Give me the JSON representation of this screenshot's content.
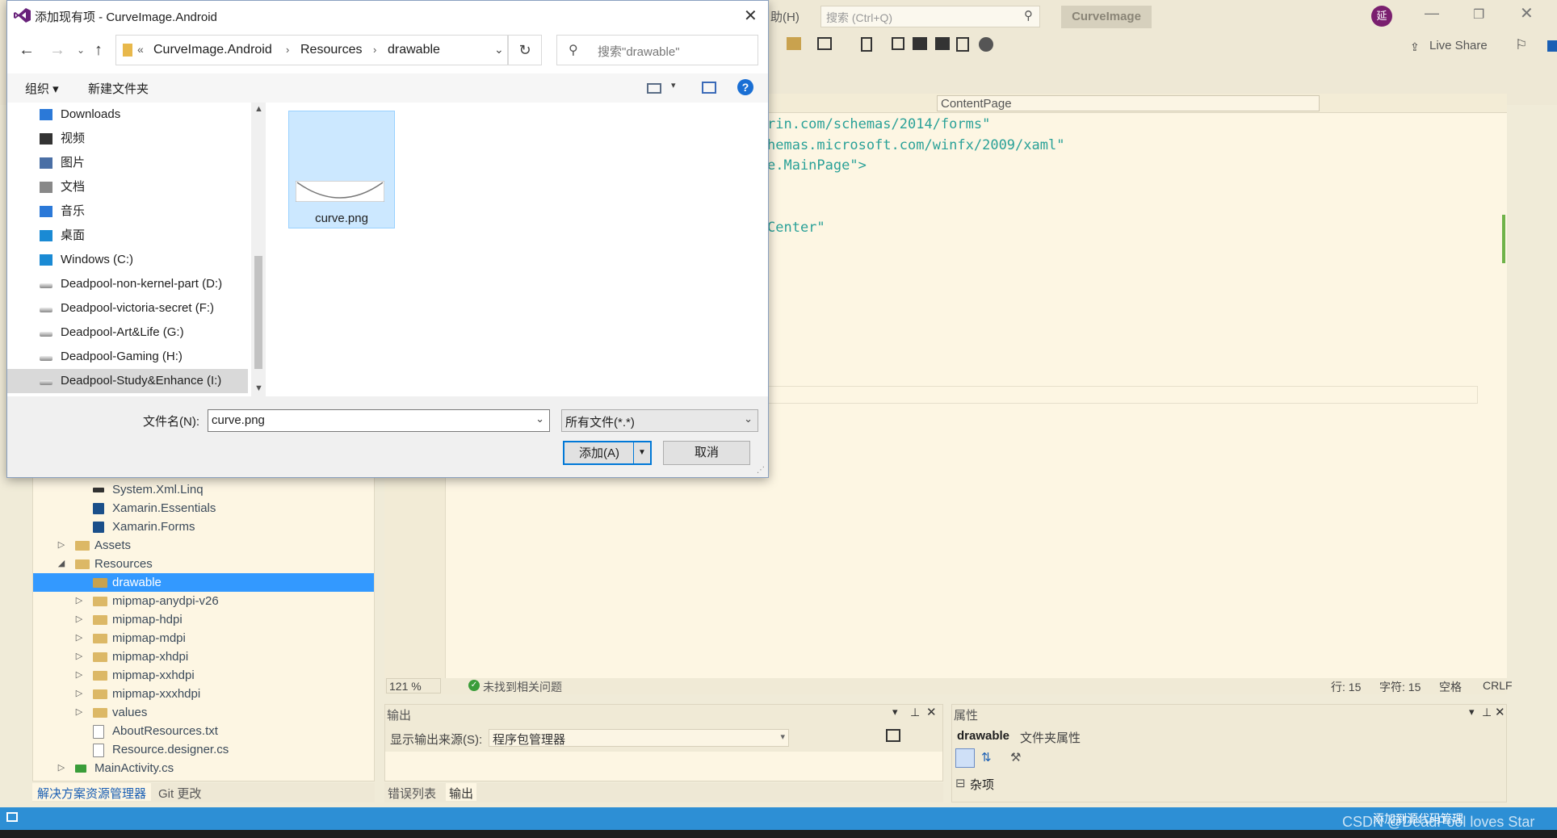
{
  "vs": {
    "menu_help_partial": "助(H)",
    "search_placeholder": "搜索 (Ctrl+Q)",
    "solution_title": "CurveImage",
    "avatar_letter": "延",
    "live_share": "Live Share",
    "editor_dropdown_right": "ContentPage",
    "code_lines": [
      "rin.com/schemas/2014/forms\"",
      "hemas.microsoft.com/winfx/2009/xaml\"",
      "e.MainPage\">",
      "",
      "",
      "",
      "Center\""
    ],
    "zoom": "121 %",
    "no_issues": "未找到相关问题",
    "line_info": "行: 15",
    "char_info": "字符: 15",
    "space_info": "空格",
    "eol_info": "CRLF",
    "output_title": "输出",
    "output_source_label": "显示输出来源(S):",
    "output_source_value": "程序包管理器",
    "props_title": "属性",
    "props_object": "drawable",
    "props_object_type": "文件夹属性",
    "props_category": "杂项",
    "bottom_tabs_left": [
      "解决方案资源管理器",
      "Git 更改"
    ],
    "bottom_tabs_mid": [
      "错误列表",
      "输出"
    ],
    "status_right": "添加到源代码管理",
    "watermark": "CSDN @DeadPool loves Star",
    "solution_tree": [
      {
        "label": "System.Xml.Linq",
        "indent": 2,
        "type": "ref"
      },
      {
        "label": "Xamarin.Essentials",
        "indent": 2,
        "type": "pkg"
      },
      {
        "label": "Xamarin.Forms",
        "indent": 2,
        "type": "pkg"
      },
      {
        "label": "Assets",
        "indent": 1,
        "type": "folder",
        "arrow": "▷"
      },
      {
        "label": "Resources",
        "indent": 1,
        "type": "folder",
        "arrow": "◢"
      },
      {
        "label": "drawable",
        "indent": 2,
        "type": "folder",
        "selected": true
      },
      {
        "label": "mipmap-anydpi-v26",
        "indent": 2,
        "type": "folder",
        "arrow": "▷"
      },
      {
        "label": "mipmap-hdpi",
        "indent": 2,
        "type": "folder",
        "arrow": "▷"
      },
      {
        "label": "mipmap-mdpi",
        "indent": 2,
        "type": "folder",
        "arrow": "▷"
      },
      {
        "label": "mipmap-xhdpi",
        "indent": 2,
        "type": "folder",
        "arrow": "▷"
      },
      {
        "label": "mipmap-xxhdpi",
        "indent": 2,
        "type": "folder",
        "arrow": "▷"
      },
      {
        "label": "mipmap-xxxhdpi",
        "indent": 2,
        "type": "folder",
        "arrow": "▷"
      },
      {
        "label": "values",
        "indent": 2,
        "type": "folder",
        "arrow": "▷"
      },
      {
        "label": "AboutResources.txt",
        "indent": 2,
        "type": "file"
      },
      {
        "label": "Resource.designer.cs",
        "indent": 2,
        "type": "file"
      },
      {
        "label": "MainActivity.cs",
        "indent": 1,
        "type": "cs",
        "arrow": "▷"
      }
    ]
  },
  "dialog": {
    "title": "添加现有项 - CurveImage.Android",
    "breadcrumb": [
      "CurveImage.Android",
      "Resources",
      "drawable"
    ],
    "breadcrumb_overflow": "«",
    "search_placeholder": "搜索\"drawable\"",
    "organize": "组织 ▾",
    "new_folder": "新建文件夹",
    "nav_items": [
      {
        "label": "Downloads",
        "icon": "download-icon"
      },
      {
        "label": "视频",
        "icon": "video-icon"
      },
      {
        "label": "图片",
        "icon": "picture-icon"
      },
      {
        "label": "文档",
        "icon": "document-icon"
      },
      {
        "label": "音乐",
        "icon": "music-icon"
      },
      {
        "label": "桌面",
        "icon": "desktop-icon"
      },
      {
        "label": "Windows (C:)",
        "icon": "windows-drive-icon"
      },
      {
        "label": "Deadpool-non-kernel-part (D:)",
        "icon": "drive-icon"
      },
      {
        "label": "Deadpool-victoria-secret (F:)",
        "icon": "drive-icon"
      },
      {
        "label": "Deadpool-Art&Life (G:)",
        "icon": "drive-icon"
      },
      {
        "label": "Deadpool-Gaming (H:)",
        "icon": "drive-icon"
      },
      {
        "label": "Deadpool-Study&Enhance (I:)",
        "icon": "drive-icon",
        "selected": true
      }
    ],
    "file": {
      "name": "curve.png"
    },
    "filename_label": "文件名(N):",
    "filename_value": "curve.png",
    "filetype_value": "所有文件(*.*)",
    "add_button": "添加(A)",
    "cancel_button": "取消"
  }
}
